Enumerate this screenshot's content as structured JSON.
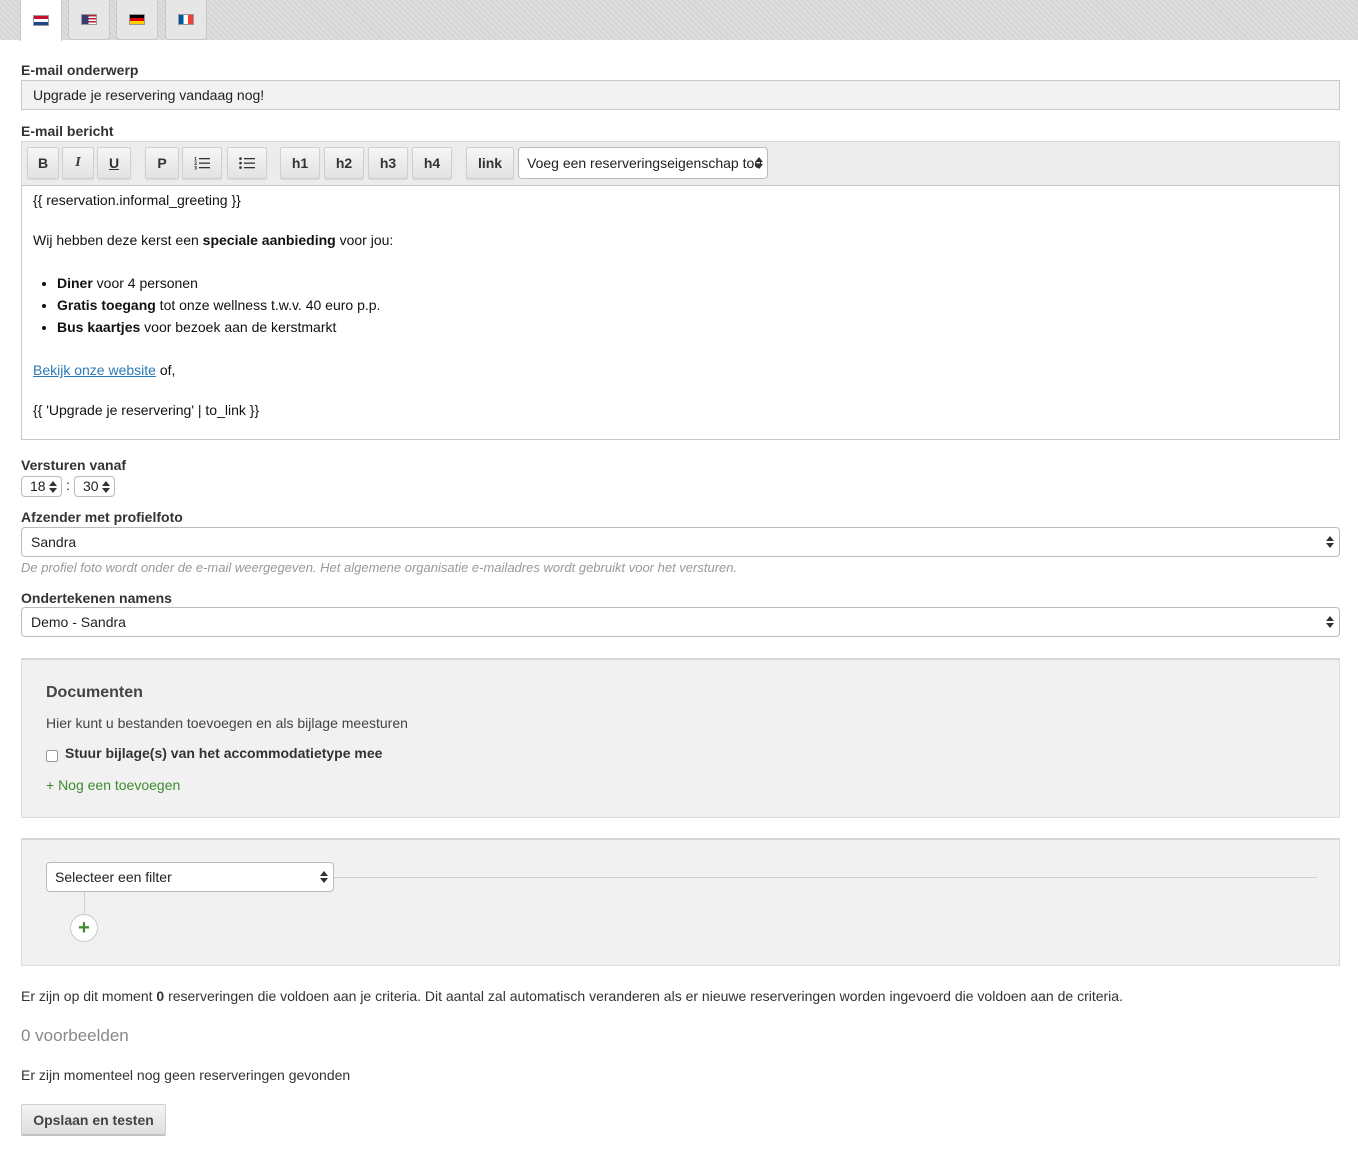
{
  "tabs": [
    {
      "flag": "flag-nl",
      "active": true
    },
    {
      "flag": "flag-us",
      "active": false
    },
    {
      "flag": "flag-de",
      "active": false
    },
    {
      "flag": "flag-fr",
      "active": false
    }
  ],
  "subject": {
    "label": "E-mail onderwerp",
    "value": "Upgrade je reservering vandaag nog!"
  },
  "message": {
    "label": "E-mail bericht",
    "toolbar": {
      "bold": "B",
      "italic": "I",
      "underline": "U",
      "paragraph": "P",
      "h1": "h1",
      "h2": "h2",
      "h3": "h3",
      "h4": "h4",
      "link": "link",
      "property_select": "Voeg een reserveringseigenschap toe"
    },
    "body": {
      "greeting": "{{ reservation.informal_greeting }}",
      "intro_before": "Wij hebben deze kerst een ",
      "intro_bold": "speciale aanbieding",
      "intro_after": " voor jou:",
      "items": [
        {
          "bold": "Diner",
          "rest": " voor 4 personen"
        },
        {
          "bold": "Gratis toegang",
          "rest": " tot onze wellness t.w.v. 40 euro p.p."
        },
        {
          "bold": "Bus kaartjes",
          "rest": " voor bezoek aan de kerstmarkt"
        }
      ],
      "website_link": "Bekijk onze website",
      "website_suffix": " of,",
      "upgrade_line": "{{ 'Upgrade je reservering' | to_link }}"
    }
  },
  "send_from": {
    "label": "Versturen vanaf",
    "hour": "18",
    "separator": ":",
    "minute": "30"
  },
  "sender": {
    "label": "Afzender met profielfoto",
    "value": "Sandra",
    "hint": "De profiel foto wordt onder de e-mail weergegeven. Het algemene organisatie e-mailadres wordt gebruikt voor het versturen."
  },
  "sign_on_behalf": {
    "label": "Ondertekenen namens",
    "value": "Demo - Sandra"
  },
  "documents": {
    "title": "Documenten",
    "description": "Hier kunt u bestanden toevoegen en als bijlage meesturen",
    "checkbox_label": "Stuur bijlage(s) van het accommodatietype mee",
    "add_link": "+ Nog een toevoegen"
  },
  "filter": {
    "select_value": "Selecteer een filter",
    "add_symbol": "+"
  },
  "criteria_info": {
    "before": "Er zijn op dit moment ",
    "count": "0",
    "after": " reserveringen die voldoen aan je criteria. Dit aantal zal automatisch veranderen als er nieuwe reserveringen worden ingevoerd die voldoen aan de criteria."
  },
  "examples": "0 voorbeelden",
  "no_reservations": "Er zijn momenteel nog geen reserveringen gevonden",
  "save_button": "Opslaan en testen"
}
